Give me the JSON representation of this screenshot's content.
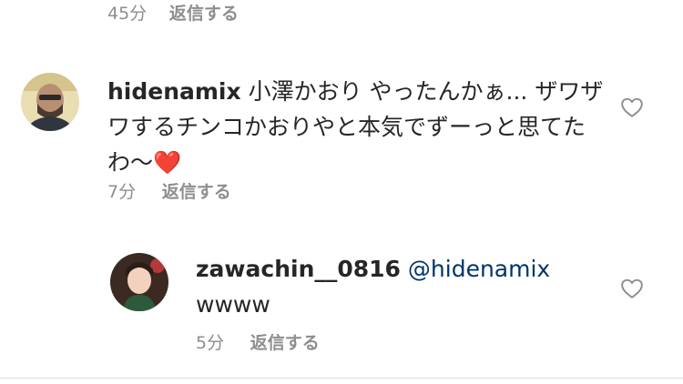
{
  "top_meta": {
    "time": "45分",
    "reply": "返信する"
  },
  "comments": [
    {
      "username": "hidenamix",
      "text": "小澤かおり やったんかぁ... ザワザワするチンコかおりやと本気でずーっと思てたわ〜",
      "emoji": "❤️",
      "time": "7分",
      "reply": "返信する"
    },
    {
      "username": "zawachin__0816",
      "mention": "@hidenamix",
      "text": "wwww",
      "time": "5分",
      "reply": "返信する"
    }
  ],
  "icons": {
    "like": "heart-outline-icon",
    "emoji": "red-heart-emoji"
  },
  "colors": {
    "username": "#262626",
    "mention": "#003569",
    "meta": "#8e8e8e",
    "divider": "#dbdbdb"
  }
}
